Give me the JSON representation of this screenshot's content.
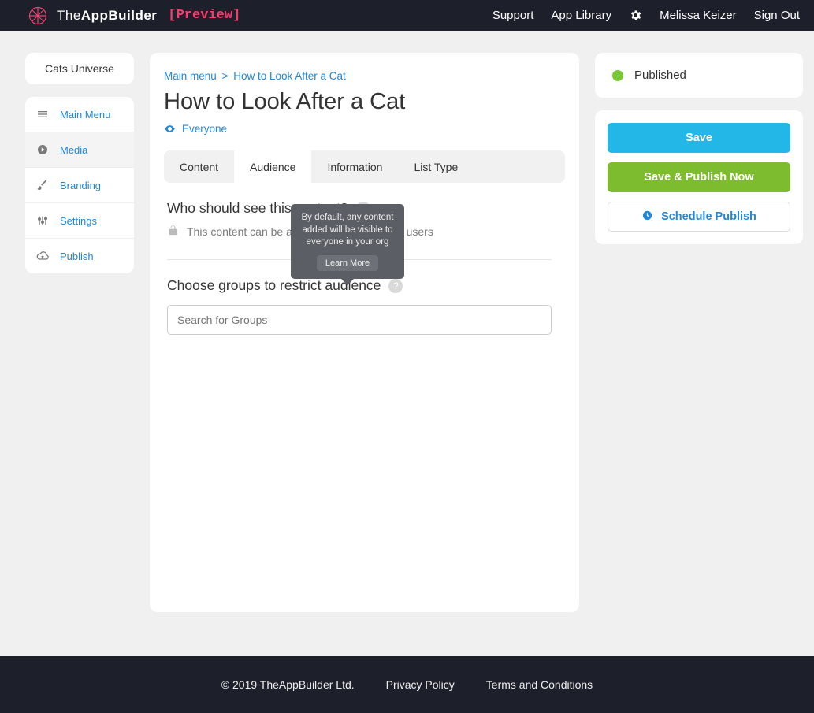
{
  "brand": {
    "name_html": "TheAppBuilder",
    "preview_tag": "[Preview]"
  },
  "topnav": {
    "support": "Support",
    "library": "App Library",
    "user": "Melissa Keizer",
    "signout": "Sign Out"
  },
  "leftcol": {
    "app_name": "Cats Universe"
  },
  "sidenav": [
    {
      "id": "main",
      "label": "Main Menu",
      "icon": "menu"
    },
    {
      "id": "media",
      "label": "Media",
      "icon": "play"
    },
    {
      "id": "brand",
      "label": "Branding",
      "icon": "brush"
    },
    {
      "id": "settings",
      "label": "Settings",
      "icon": "sliders"
    },
    {
      "id": "publish",
      "label": "Publish",
      "icon": "cloud"
    }
  ],
  "crumbs": {
    "root": "Main menu",
    "sep": ">",
    "current": "How to Look After a Cat"
  },
  "page_title": "How to Look After a Cat",
  "visibility": "Everyone",
  "tabs": [
    "Content",
    "Audience",
    "Information",
    "List Type"
  ],
  "section1": {
    "title": "Who should see this content?",
    "access_line": "This content can be accessed by all channel users"
  },
  "section2": {
    "title": "Choose groups to restrict audience",
    "search_placeholder": "Search for Groups"
  },
  "tooltip": {
    "text": "By default, any content added will be visible to everyone in your org",
    "learn": "Learn More"
  },
  "status": {
    "label": "Published"
  },
  "actions": {
    "save": "Save",
    "publish": "Save & Publish Now",
    "schedule": "Schedule Publish"
  },
  "footer": {
    "copyright": "© 2019 TheAppBuilder Ltd.",
    "privacy": "Privacy Policy",
    "terms": "Terms and Conditions"
  }
}
